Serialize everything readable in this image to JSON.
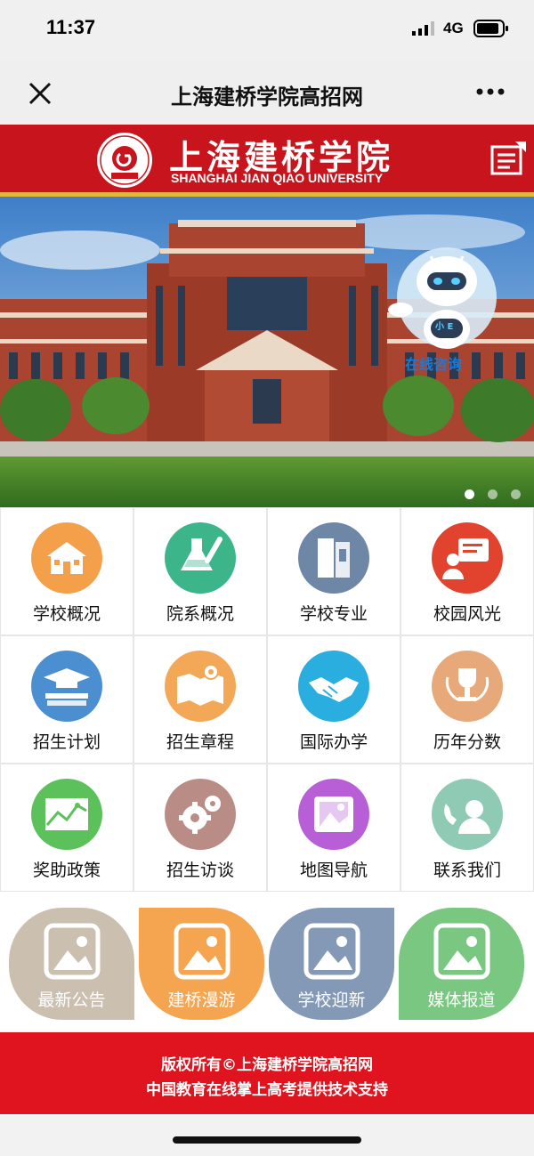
{
  "status_bar": {
    "time": "11:37",
    "network": "4G"
  },
  "nav": {
    "title": "上海建桥学院高招网"
  },
  "header": {
    "seal_text": "上海建桥学院 GENCH SHANGHAI JIAN QIAO UNIVERSITY",
    "name_cn": "上海建桥学院",
    "name_en": "SHANGHAI JIAN QIAO UNIVERSITY"
  },
  "banner": {
    "consult_label": "在线咨询",
    "robot_badge": "小 E",
    "slides": 3,
    "active_slide": 0
  },
  "menu_items": [
    {
      "label": "学校概况",
      "icon": "school-building-icon",
      "color": "#f4a04a"
    },
    {
      "label": "院系概况",
      "icon": "lab-flask-icon",
      "color": "#3cb58a"
    },
    {
      "label": "学校专业",
      "icon": "books-icon",
      "color": "#6e87a6"
    },
    {
      "label": "校园风光",
      "icon": "presentation-icon",
      "color": "#e2432e"
    },
    {
      "label": "招生计划",
      "icon": "graduation-cap-icon",
      "color": "#4b8fd1"
    },
    {
      "label": "招生章程",
      "icon": "map-pin-icon",
      "color": "#f3a858"
    },
    {
      "label": "国际办学",
      "icon": "handshake-icon",
      "color": "#2aaee0"
    },
    {
      "label": "历年分数",
      "icon": "trophy-icon",
      "color": "#e7a97a"
    },
    {
      "label": "奖助政策",
      "icon": "growth-chart-icon",
      "color": "#5cc15a"
    },
    {
      "label": "招生访谈",
      "icon": "gears-icon",
      "color": "#b98d86"
    },
    {
      "label": "地图导航",
      "icon": "picture-frame-icon",
      "color": "#b85ed6"
    },
    {
      "label": "联系我们",
      "icon": "contact-phone-icon",
      "color": "#8fcbb4"
    }
  ],
  "cards": [
    {
      "label": "最新公告",
      "color": "#cbbfb0"
    },
    {
      "label": "建桥漫游",
      "color": "#f5a54f"
    },
    {
      "label": "学校迎新",
      "color": "#8399b5"
    },
    {
      "label": "媒体报道",
      "color": "#79c780"
    }
  ],
  "footer": {
    "line1": "版权所有©上海建桥学院高招网",
    "line2": "中国教育在线掌上高考提供技术支持"
  },
  "colors": {
    "brand_red": "#c8151d",
    "footer_red": "#e0141e",
    "gold": "#e0b73a"
  }
}
